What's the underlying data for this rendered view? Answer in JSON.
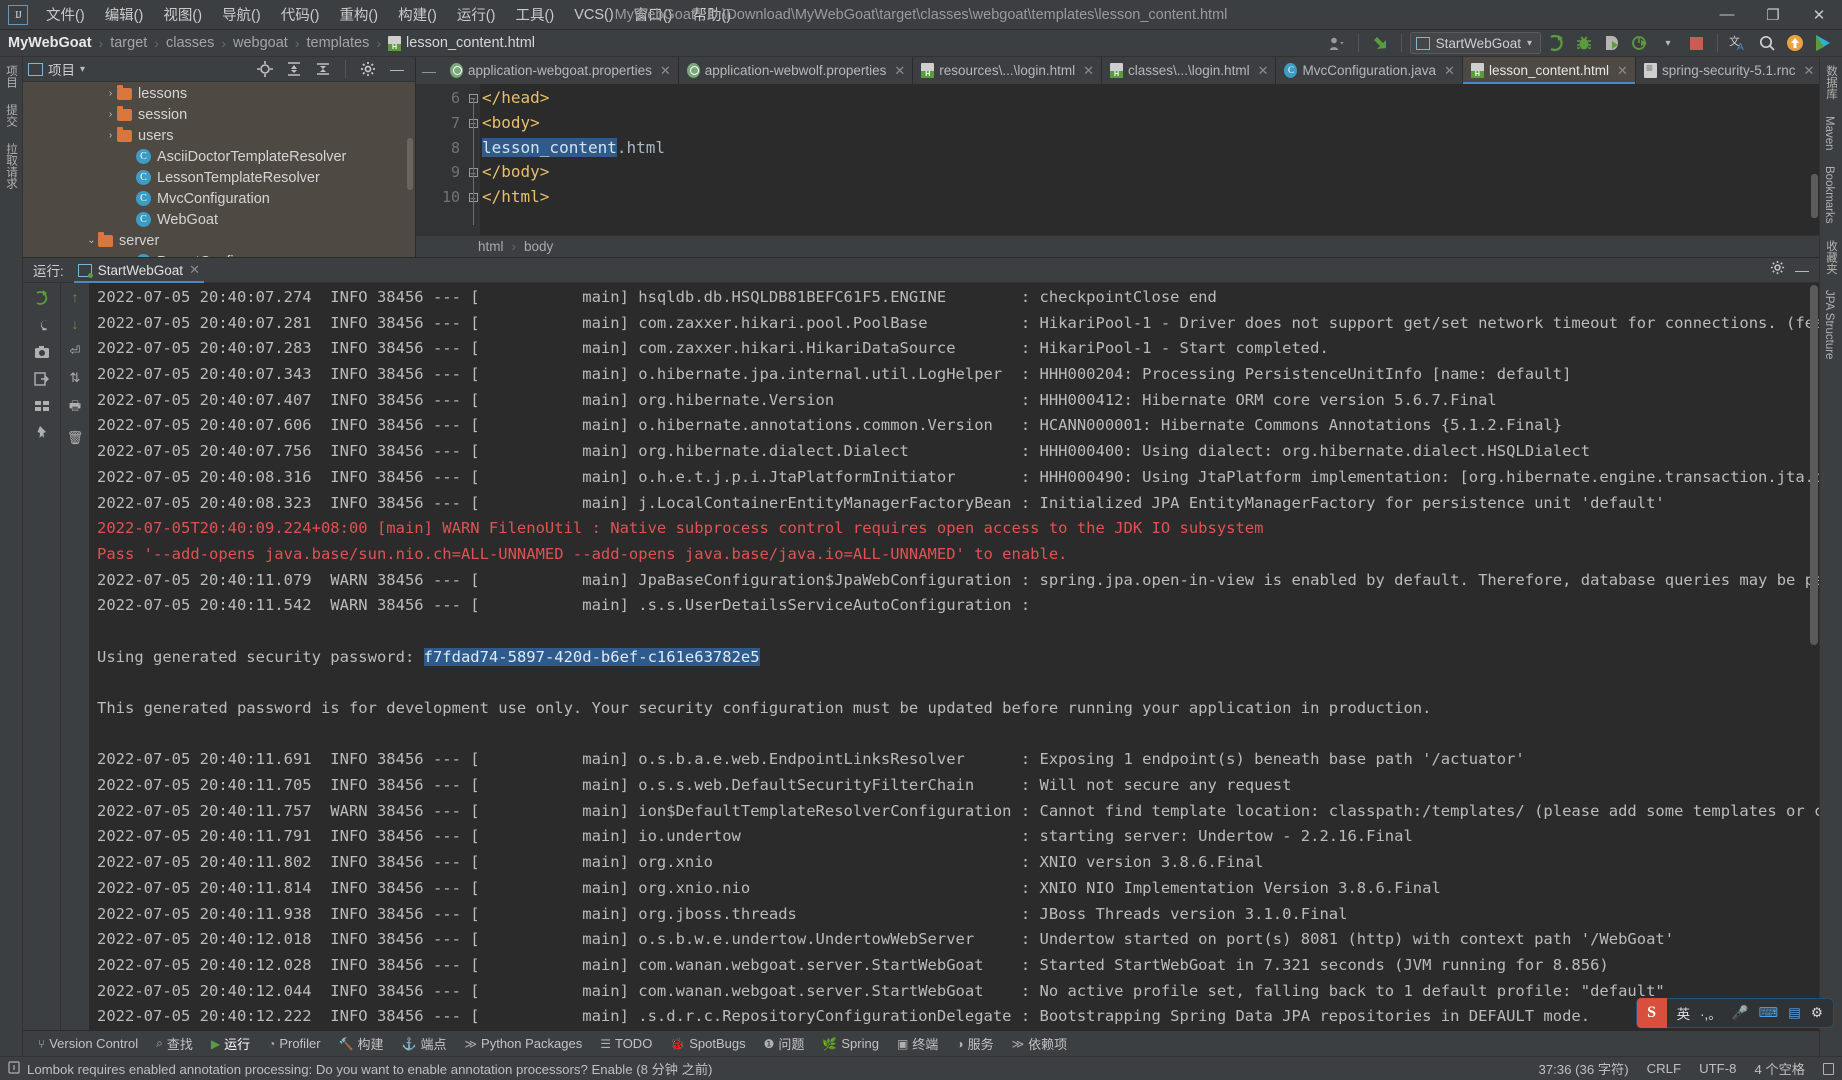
{
  "window": {
    "title": "MyWebGoat - D:\\Download\\MyWebGoat\\target\\classes\\webgoat\\templates\\lesson_content.html",
    "logo": "intellij-logo",
    "minimize": "—",
    "maximize": "❐",
    "close": "✕"
  },
  "menubar": [
    {
      "label": "文件(F)"
    },
    {
      "label": "编辑(E)"
    },
    {
      "label": "视图(V)"
    },
    {
      "label": "导航(N)"
    },
    {
      "label": "代码(C)"
    },
    {
      "label": "重构(R)"
    },
    {
      "label": "构建(B)"
    },
    {
      "label": "运行(U)"
    },
    {
      "label": "工具(T)"
    },
    {
      "label": "VCS(S)"
    },
    {
      "label": "窗口(W)"
    },
    {
      "label": "帮助(H)"
    }
  ],
  "breadcrumb": {
    "items": [
      "MyWebGoat",
      "target",
      "classes",
      "webgoat",
      "templates"
    ],
    "file": "lesson_content.html",
    "separator": "›"
  },
  "toolbar": {
    "run_config": "StartWebGoat",
    "dropdown_caret": "▾",
    "icons": [
      {
        "name": "user-avatar-icon",
        "glyph": "♟"
      },
      {
        "name": "update-project-icon",
        "glyph": "↖"
      },
      {
        "name": "run-icon",
        "glyph": "▶"
      },
      {
        "name": "debug-icon",
        "glyph": "⚙"
      },
      {
        "name": "coverage-icon",
        "glyph": "▷"
      },
      {
        "name": "profiler-icon",
        "glyph": "⦿"
      },
      {
        "name": "stop-icon",
        "glyph": "■"
      },
      {
        "name": "translate-icon",
        "glyph": "文"
      },
      {
        "name": "search-everywhere-icon",
        "glyph": "⌕"
      },
      {
        "name": "notification-icon",
        "glyph": "↑"
      },
      {
        "name": "ide-features-icon",
        "glyph": "▶"
      }
    ]
  },
  "project_panel": {
    "title": "项目",
    "caret": "▾",
    "header_icons": [
      "locate-icon",
      "expand-all-icon",
      "collapse-all-icon",
      "settings-gear-icon",
      "hide-icon"
    ],
    "tree": [
      {
        "indent": 3,
        "arrow": "›",
        "kind": "folder",
        "label": "lessons"
      },
      {
        "indent": 3,
        "arrow": "›",
        "kind": "folder",
        "label": "session"
      },
      {
        "indent": 3,
        "arrow": "›",
        "kind": "folder",
        "label": "users"
      },
      {
        "indent": 4,
        "arrow": "",
        "kind": "class",
        "label": "AsciiDoctorTemplateResolver"
      },
      {
        "indent": 4,
        "arrow": "",
        "kind": "class",
        "label": "LessonTemplateResolver"
      },
      {
        "indent": 4,
        "arrow": "",
        "kind": "class",
        "label": "MvcConfiguration"
      },
      {
        "indent": 4,
        "arrow": "",
        "kind": "class-runnable",
        "label": "WebGoat"
      },
      {
        "indent": 2,
        "arrow": "⌄",
        "kind": "folder",
        "label": "server"
      },
      {
        "indent": 4,
        "arrow": "",
        "kind": "class",
        "label": "ParentConfig"
      }
    ]
  },
  "editor": {
    "tabs": [
      {
        "label": "application-webgoat.properties",
        "icon": "properties-file-icon",
        "active": false
      },
      {
        "label": "application-webwolf.properties",
        "icon": "properties-file-icon",
        "active": false
      },
      {
        "label": "resources\\...\\login.html",
        "icon": "html-file-icon",
        "active": false
      },
      {
        "label": "classes\\...\\login.html",
        "icon": "html-file-icon",
        "active": false
      },
      {
        "label": "MvcConfiguration.java",
        "icon": "java-file-icon",
        "active": false
      },
      {
        "label": "lesson_content.html",
        "icon": "html-file-icon",
        "active": true
      },
      {
        "label": "spring-security-5.1.rnc",
        "icon": "rnc-file-icon",
        "active": false
      }
    ],
    "close_glyph": "✕",
    "lines": [
      {
        "num": "6",
        "fold": "⊖",
        "segments": [
          {
            "t": "</head>",
            "c": "tag"
          }
        ]
      },
      {
        "num": "7",
        "fold": "⊖",
        "segments": [
          {
            "t": "<body>",
            "c": "tag"
          }
        ]
      },
      {
        "num": "8",
        "fold": "",
        "segments": [
          {
            "t": "lesson_content",
            "c": "sel"
          },
          {
            "t": ".html",
            "c": "plain"
          }
        ]
      },
      {
        "num": "9",
        "fold": "⊖",
        "segments": [
          {
            "t": "</body>",
            "c": "tag"
          }
        ]
      },
      {
        "num": "10",
        "fold": "⊖",
        "segments": [
          {
            "t": "</html>",
            "c": "tag"
          }
        ]
      }
    ],
    "breadcrumbs": [
      "html",
      "body"
    ],
    "inspection_ok": "✓"
  },
  "run_window": {
    "label": "运行:",
    "tab": "StartWebGoat",
    "close_glyph": "✕",
    "settings_glyph": "⚙",
    "hide_glyph": "—",
    "rail_icons": [
      "rerun-icon",
      "scroll-up-icon",
      "stop-icon",
      "scroll-down-icon",
      "wrench-icon",
      "filter-icon",
      "camera-icon",
      "sort-icon",
      "print-icon",
      "export-icon",
      "soft-wrap-icon",
      "trash-icon",
      "grid-icon",
      "pin-icon"
    ],
    "console": [
      {
        "class": "normal",
        "text": "2022-07-05 20:40:07.274  INFO 38456 --- [           main] hsqldb.db.HSQLDB81BEFC61F5.ENGINE        : checkpointClose end"
      },
      {
        "class": "normal",
        "text": "2022-07-05 20:40:07.281  INFO 38456 --- [           main] com.zaxxer.hikari.pool.PoolBase          : HikariPool-1 - Driver does not support get/set network timeout for connections. (feature no"
      },
      {
        "class": "normal",
        "text": "2022-07-05 20:40:07.283  INFO 38456 --- [           main] com.zaxxer.hikari.HikariDataSource       : HikariPool-1 - Start completed."
      },
      {
        "class": "normal",
        "text": "2022-07-05 20:40:07.343  INFO 38456 --- [           main] o.hibernate.jpa.internal.util.LogHelper  : HHH000204: Processing PersistenceUnitInfo [name: default]"
      },
      {
        "class": "normal",
        "text": "2022-07-05 20:40:07.407  INFO 38456 --- [           main] org.hibernate.Version                    : HHH000412: Hibernate ORM core version 5.6.7.Final"
      },
      {
        "class": "normal",
        "text": "2022-07-05 20:40:07.606  INFO 38456 --- [           main] o.hibernate.annotations.common.Version   : HCANN000001: Hibernate Commons Annotations {5.1.2.Final}"
      },
      {
        "class": "normal",
        "text": "2022-07-05 20:40:07.756  INFO 38456 --- [           main] org.hibernate.dialect.Dialect            : HHH000400: Using dialect: org.hibernate.dialect.HSQLDialect"
      },
      {
        "class": "normal",
        "text": "2022-07-05 20:40:08.316  INFO 38456 --- [           main] o.h.e.t.j.p.i.JtaPlatformInitiator       : HHH000490: Using JtaPlatform implementation: [org.hibernate.engine.transaction.jta.platform"
      },
      {
        "class": "normal",
        "text": "2022-07-05 20:40:08.323  INFO 38456 --- [           main] j.LocalContainerEntityManagerFactoryBean : Initialized JPA EntityManagerFactory for persistence unit 'default'"
      },
      {
        "class": "red",
        "text": "2022-07-05T20:40:09.224+08:00 [main] WARN FilenoUtil : Native subprocess control requires open access to the JDK IO subsystem"
      },
      {
        "class": "red",
        "text": "Pass '--add-opens java.base/sun.nio.ch=ALL-UNNAMED --add-opens java.base/java.io=ALL-UNNAMED' to enable."
      },
      {
        "class": "normal",
        "text": "2022-07-05 20:40:11.079  WARN 38456 --- [           main] JpaBaseConfiguration$JpaWebConfiguration : spring.jpa.open-in-view is enabled by default. Therefore, database queries may be performed"
      },
      {
        "class": "normal",
        "text": "2022-07-05 20:40:11.542  WARN 38456 --- [           main] .s.s.UserDetailsServiceAutoConfiguration :"
      },
      {
        "class": "blank",
        "text": ""
      },
      {
        "class": "password",
        "prefix": "Using generated security password: ",
        "selected": "f7fdad74-5897-420d-b6ef-c161e63782e5"
      },
      {
        "class": "blank",
        "text": ""
      },
      {
        "class": "normal",
        "text": "This generated password is for development use only. Your security configuration must be updated before running your application in production."
      },
      {
        "class": "blank",
        "text": ""
      },
      {
        "class": "normal",
        "text": "2022-07-05 20:40:11.691  INFO 38456 --- [           main] o.s.b.a.e.web.EndpointLinksResolver      : Exposing 1 endpoint(s) beneath base path '/actuator'"
      },
      {
        "class": "normal",
        "text": "2022-07-05 20:40:11.705  INFO 38456 --- [           main] o.s.s.web.DefaultSecurityFilterChain     : Will not secure any request"
      },
      {
        "class": "normal",
        "text": "2022-07-05 20:40:11.757  WARN 38456 --- [           main] ion$DefaultTemplateResolverConfiguration : Cannot find template location: classpath:/templates/ (please add some templates or check yo"
      },
      {
        "class": "normal",
        "text": "2022-07-05 20:40:11.791  INFO 38456 --- [           main] io.undertow                              : starting server: Undertow - 2.2.16.Final"
      },
      {
        "class": "normal",
        "text": "2022-07-05 20:40:11.802  INFO 38456 --- [           main] org.xnio                                 : XNIO version 3.8.6.Final"
      },
      {
        "class": "normal",
        "text": "2022-07-05 20:40:11.814  INFO 38456 --- [           main] org.xnio.nio                             : XNIO NIO Implementation Version 3.8.6.Final"
      },
      {
        "class": "normal",
        "text": "2022-07-05 20:40:11.938  INFO 38456 --- [           main] org.jboss.threads                        : JBoss Threads version 3.1.0.Final"
      },
      {
        "class": "normal",
        "text": "2022-07-05 20:40:12.018  INFO 38456 --- [           main] o.s.b.w.e.undertow.UndertowWebServer     : Undertow started on port(s) 8081 (http) with context path '/WebGoat'"
      },
      {
        "class": "normal",
        "text": "2022-07-05 20:40:12.028  INFO 38456 --- [           main] com.wanan.webgoat.server.StartWebGoat    : Started StartWebGoat in 7.321 seconds (JVM running for 8.856)"
      },
      {
        "class": "normal",
        "text": "2022-07-05 20:40:12.044  INFO 38456 --- [           main] com.wanan.webgoat.server.StartWebGoat    : No active profile set, falling back to 1 default profile: \"default\""
      },
      {
        "class": "normal",
        "text": "2022-07-05 20:40:12.222  INFO 38456 --- [           main] .s.d.r.c.RepositoryConfigurationDelegate : Bootstrapping Spring Data JPA repositories in DEFAULT mode."
      }
    ]
  },
  "left_rail": [
    {
      "label": "项目",
      "name": "tool-project"
    },
    {
      "label": "提交",
      "name": "tool-commit"
    },
    {
      "label": "拉取请求",
      "name": "tool-pull-requests"
    }
  ],
  "right_rail": [
    {
      "label": "数据库",
      "name": "tool-database"
    },
    {
      "label": "Maven",
      "name": "tool-maven"
    },
    {
      "label": "Bookmarks",
      "name": "tool-bookmarks"
    },
    {
      "label": "收藏夹",
      "name": "tool-favorites"
    },
    {
      "label": "JPA Structure",
      "name": "tool-jpa-structure"
    }
  ],
  "bottom_toolbar": [
    {
      "label": "Version Control",
      "icon": "branch-icon",
      "active": false
    },
    {
      "label": "查找",
      "icon": "search-icon",
      "active": false
    },
    {
      "label": "运行",
      "icon": "run-icon",
      "active": true
    },
    {
      "label": "Profiler",
      "icon": "profiler-icon",
      "active": false
    },
    {
      "label": "构建",
      "icon": "build-icon",
      "active": false
    },
    {
      "label": "端点",
      "icon": "endpoints-icon",
      "active": false
    },
    {
      "label": "Python Packages",
      "icon": "python-icon",
      "active": false
    },
    {
      "label": "TODO",
      "icon": "todo-icon",
      "active": false
    },
    {
      "label": "SpotBugs",
      "icon": "spotbugs-icon",
      "active": false
    },
    {
      "label": "问题",
      "icon": "problems-icon",
      "active": false
    },
    {
      "label": "Spring",
      "icon": "spring-icon",
      "active": false
    },
    {
      "label": "终端",
      "icon": "terminal-icon",
      "active": false
    },
    {
      "label": "服务",
      "icon": "services-icon",
      "active": false
    },
    {
      "label": "依赖项",
      "icon": "dependencies-icon",
      "active": false
    }
  ],
  "statusbar": {
    "message": "Lombok requires enabled annotation processing: Do you want to enable annotation processors? Enable (8 分钟 之前)",
    "message_icon": "info-icon",
    "caret_position": "37:36 (36 字符)",
    "line_separator": "CRLF",
    "encoding": "UTF-8",
    "indent": "4 个空格",
    "lock_icon": "unlocked-icon"
  },
  "ime_popup": {
    "badge": "S",
    "mode": "英",
    "items": [
      "·,。",
      "🎤",
      "⌨",
      "▤",
      "⚙"
    ]
  },
  "colors": {
    "accent_blue": "#4a88c7",
    "selection_blue": "#2f5b8c",
    "warning_red": "#e05252",
    "tag_orange": "#e8bf6a",
    "folder_orange": "#d9763c",
    "class_blue": "#3d9cc4",
    "panel_bg": "#3c3f41",
    "editor_bg": "#2b2b2b",
    "tree_bg": "#4e4a43"
  }
}
